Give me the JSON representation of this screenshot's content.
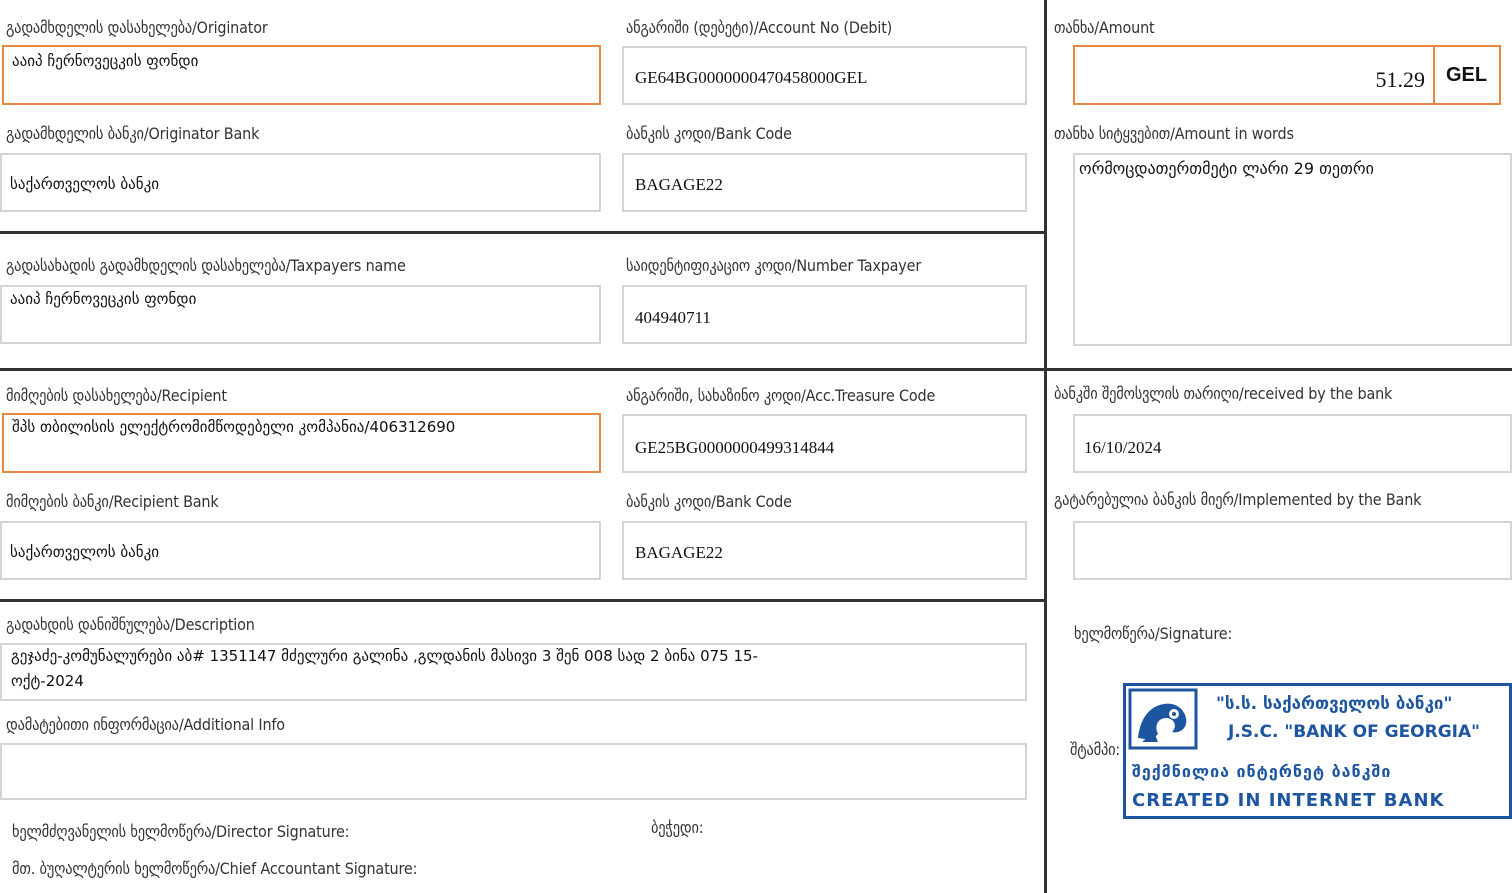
{
  "originator": {
    "label": "გადამხდელის დასახელება/Originator",
    "value": "ააიპ ჩერნოვეცკის ფონდი"
  },
  "account_debit": {
    "label": "ანგარიში (დებეტი)/Account No (Debit)",
    "value": "GE64BG0000000470458000GEL"
  },
  "amount": {
    "label": "თანხა/Amount",
    "value": "51.29",
    "currency": "GEL"
  },
  "originator_bank": {
    "label": "გადამხდელის ბანკი/Originator Bank",
    "value": "საქართველოს ბანკი"
  },
  "originator_bank_code": {
    "label": "ბანკის კოდი/Bank Code",
    "value": "BAGAGE22"
  },
  "amount_words": {
    "label": "თანხა სიტყვებით/Amount in words",
    "value": "ორმოცდათერთმეტი ლარი 29 თეთრი"
  },
  "taxpayer_name": {
    "label": "გადასახადის გადამხდელის დასახელება/Taxpayers name",
    "value": "ააიპ ჩერნოვეცკის ფონდი"
  },
  "taxpayer_code": {
    "label": "საიდენტიფიკაციო კოდი/Number Taxpayer",
    "value": "404940711"
  },
  "recipient": {
    "label": "მიმღების დასახელება/Recipient",
    "value": "შპს თბილისის ელექტრომიმწოდებელი კომპანია/406312690"
  },
  "recipient_account": {
    "label": "ანგარიში, სახაზინო კოდი/Acc.Treasure Code",
    "value": "GE25BG0000000499314844"
  },
  "received_date": {
    "label": "ბანკში შემოსვლის თარიღი/received by the bank",
    "value": "16/10/2024"
  },
  "recipient_bank": {
    "label": "მიმღების ბანკი/Recipient Bank",
    "value": "საქართველოს ბანკი"
  },
  "recipient_bank_code": {
    "label": "ბანკის კოდი/Bank Code",
    "value": "BAGAGE22"
  },
  "implemented": {
    "label": "გატარებულია ბანკის მიერ/Implemented by the Bank",
    "value": ""
  },
  "description": {
    "label": "გადახდის დანიშნულება/Description",
    "line1": "გეჯაძე-კომუნალურები აბ# 1351147 მძელური გალინა ,გლდანის მასივი 3 შენ 008 სად 2 ბინა 075 15-",
    "line2": "ოქტ-2024"
  },
  "additional_info": {
    "label": "დამატებითი ინფორმაცია/Additional Info",
    "value": ""
  },
  "signature_label": "ხელმოწერა/Signature:",
  "stamp_label": "შტამპი:",
  "director_signature": "ხელმძღვანელის ხელმოწერა/Director Signature:",
  "seal_label": "ბეჭედი:",
  "chief_accountant_signature": "მთ. ბუღალტერის ხელმოწერა/Chief Accountant Signature:",
  "stamp": {
    "line1": "\"ს.ს.  საქართველოს ბანკი\"",
    "line2": "J.S.C.  \"BANK OF GEORGIA\"",
    "line3": "შექმნილია ინტერნეტ ბანკში",
    "line4": "CREATED IN INTERNET BANK"
  },
  "colors": {
    "accent_border": "#e8873e",
    "field_border": "#d4d4d4",
    "stamp": "#1d55a0"
  }
}
